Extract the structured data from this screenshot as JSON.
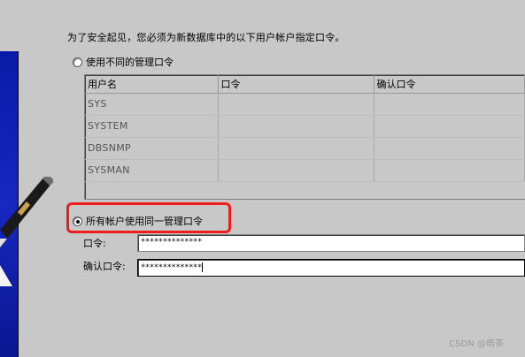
{
  "instruction": "为了安全起见，您必须为新数据库中的以下用户帐户指定口令。",
  "options": {
    "different": {
      "label": "使用不同的管理口令",
      "selected": false
    },
    "same": {
      "label": "所有帐户使用同一管理口令",
      "selected": true
    }
  },
  "table": {
    "headers": [
      "用户名",
      "口令",
      "确认口令"
    ],
    "rows": [
      [
        "SYS",
        "",
        ""
      ],
      [
        "SYSTEM",
        "",
        ""
      ],
      [
        "DBSNMP",
        "",
        ""
      ],
      [
        "SYSMAN",
        "",
        ""
      ]
    ]
  },
  "password": {
    "label": "口令:",
    "value": "**************"
  },
  "confirm_password": {
    "label": "确认口令:",
    "value": "**************"
  },
  "watermark": "CSDN @皓茶",
  "colors": {
    "highlight": "#ee1c1c",
    "side_panel": "#1727c0"
  }
}
